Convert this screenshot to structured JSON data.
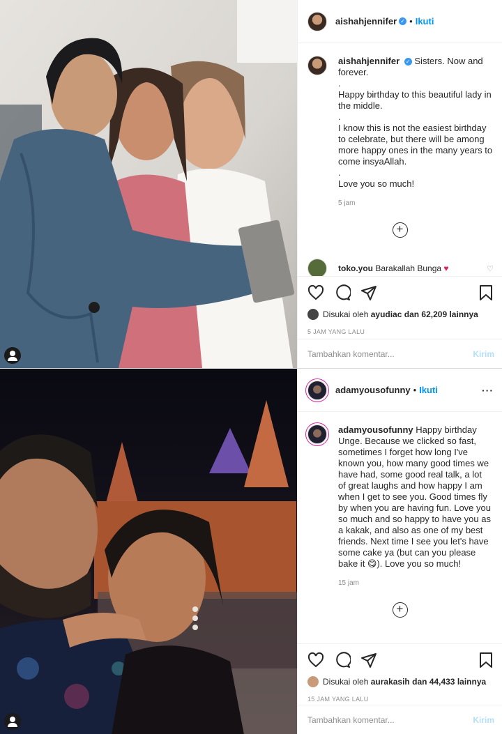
{
  "post1": {
    "username": "aishahjennifer",
    "follow": "Ikuti",
    "caption_lines": [
      "Sisters. Now and forever.",
      ".",
      "Happy birthday to this beautiful lady in the middle.",
      ".",
      "I know this is not the easiest birthday to celebrate, but there will be among more happy ones in the many years to come insyaAllah.",
      ".",
      "Love you so much!"
    ],
    "caption_time": "5 jam",
    "comment_user": "toko.you",
    "comment_text": "Barakallah Bunga",
    "liked_prefix": "Disukai oleh",
    "liked_user": "ayudiac",
    "liked_suffix": "dan 62,209 lainnya",
    "posted_ago": "5 JAM YANG LALU",
    "add_comment_placeholder": "Tambahkan komentar...",
    "post_button": "Kirim"
  },
  "post2": {
    "username": "adamyousofunny",
    "follow": "Ikuti",
    "caption": "Happy birthday Unge. Because we clicked so fast, sometimes I forget how long I've known you, how many good times we have had, some good real talk, a lot of great laughs and how happy I am when I get to see you. Good times fly by when you are having fun. Love you so much and so happy to have you as a kakak, and also as one of my best friends. Next time I see you let's have some cake ya (but can you please bake it 😋). Love you so much!",
    "caption_time": "15 jam",
    "liked_prefix": "Disukai oleh",
    "liked_user": "aurakasih",
    "liked_suffix": "dan 44,433 lainnya",
    "posted_ago": "15 JAM YANG LALU",
    "add_comment_placeholder": "Tambahkan komentar...",
    "post_button": "Kirim"
  },
  "colors": {
    "link_blue": "#0095f6",
    "verified_blue": "#3897f0",
    "muted": "#8e8e8e"
  },
  "icons": [
    "heart-icon",
    "comment-icon",
    "share-icon",
    "bookmark-icon",
    "add-comment-icon",
    "more-options-icon",
    "verified-icon",
    "tagged-user-icon"
  ]
}
